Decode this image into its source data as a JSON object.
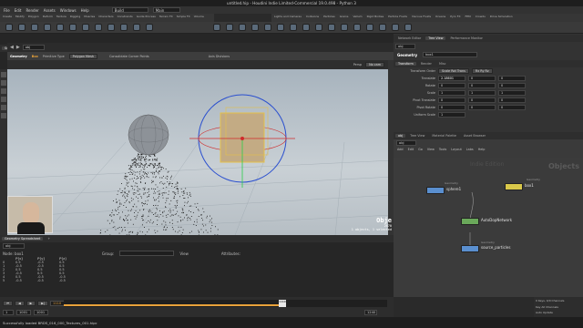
{
  "window": {
    "title": "untitled.hip - Houdini Indie Limited-Commercial 19.0.498 - Python 3"
  },
  "menu": {
    "items": [
      "File",
      "Edit",
      "Render",
      "Assets",
      "Windows",
      "Help"
    ],
    "desktop": "Build",
    "context": "Main"
  },
  "shelf_left": [
    "Create",
    "Modify",
    "Polygon",
    "Deform",
    "Texture",
    "Rigging",
    "Muscles",
    "Characters",
    "Constraints",
    "Guide Process",
    "Terrain FX",
    "Simple FX",
    "Volume"
  ],
  "shelf_right": [
    "Lights and Cameras",
    "Collisions",
    "Particles",
    "Grains",
    "Vellum",
    "Rigid Bodies",
    "Particle Fluids",
    "Viscous Fluids",
    "Oceans",
    "Pyro FX",
    "FEM",
    "Crowds",
    "Drive Simulation"
  ],
  "viewport": {
    "pane_tabs": [
      "Scene View",
      "Animation Editor",
      "Render View",
      "Composite View",
      "Motion FX View",
      "Geometry Spreadsheet"
    ],
    "path": "obj",
    "operator_bar": {
      "context": "Geometry",
      "node": "Box",
      "primitive_type_label": "Primitive Type",
      "primitive_type": "Polygon Mesh",
      "consolidate": "Consolidate Corner Points",
      "axis_label": "Axis Divisions"
    },
    "view_label": "Persp",
    "camera_label": "No cam",
    "status": {
      "title": "Obje",
      "line2": "2670",
      "line3": "1 objects, 1 selected"
    }
  },
  "spreadsheet": {
    "tabs": [
      "Geometry Spreadsheet",
      "+"
    ],
    "path": "obj",
    "node_label": "Node: box1",
    "group_label": "Group:",
    "view_label": "View",
    "attrs_label": "Attributes:",
    "columns": [
      "",
      "P[x]",
      "P[y]",
      "P[z]"
    ],
    "rows": [
      [
        "0",
        "0.5",
        "-0.5",
        "0.5"
      ],
      [
        "1",
        "-0.5",
        "-0.5",
        "0.5"
      ],
      [
        "2",
        "0.5",
        "0.5",
        "0.5"
      ],
      [
        "3",
        "-0.5",
        "0.5",
        "0.5"
      ],
      [
        "4",
        "0.5",
        "-0.5",
        "-0.5"
      ],
      [
        "5",
        "-0.5",
        "-0.5",
        "-0.5"
      ]
    ]
  },
  "timeline": {
    "frame": "1110",
    "start": "1",
    "end": "1001",
    "range_start": "1001",
    "range_end": "1240",
    "end2": "1240",
    "ticks": [
      "1001",
      "1024",
      "1072",
      "1104",
      "1120",
      "1144",
      "1168",
      "1192",
      "1216",
      "1240"
    ]
  },
  "params": {
    "tabs": [
      "Network Editor",
      "Tree View",
      "Performance Monitor"
    ],
    "path": "obj",
    "node_type": "Geometry",
    "node_name": "box1",
    "subtabs": [
      "Transform",
      "Render",
      "Misc"
    ],
    "transform_order_label": "Transform Order",
    "transform_order": "Scale Rot Trans",
    "rot_order": "Rx Ry Rz",
    "rows": [
      {
        "label": "Translate",
        "values": [
          "2.18601",
          "0",
          "0"
        ]
      },
      {
        "label": "Rotate",
        "values": [
          "0",
          "0",
          "0"
        ]
      },
      {
        "label": "Scale",
        "values": [
          "1",
          "1",
          "1"
        ]
      },
      {
        "label": "Pivot Translate",
        "values": [
          "0",
          "0",
          "0"
        ]
      },
      {
        "label": "Pivot Rotate",
        "values": [
          "0",
          "0",
          "0"
        ]
      },
      {
        "label": "Uniform Scale",
        "values": [
          "1"
        ]
      }
    ]
  },
  "network": {
    "tabs": [
      "obj",
      "Tree View",
      "Material Palette",
      "Asset Browser"
    ],
    "menu": [
      "Add",
      "Edit",
      "Go",
      "View",
      "Tools",
      "Layout",
      "Labs",
      "Help"
    ],
    "path": "obj",
    "context_title": "Objects",
    "watermark": "Indie Edition",
    "nodes": [
      {
        "type": "Geometry",
        "name": "sphere1",
        "color": "#5a8fcf"
      },
      {
        "type": "Geometry",
        "name": "box1",
        "color": "#d9c84a"
      },
      {
        "type": "AutoDopNetwork",
        "name": "AutoDopNetwork",
        "color": "#6aa85a"
      },
      {
        "type": "Geometry",
        "name": "source_particles",
        "color": "#5a8fcf"
      }
    ],
    "footer": [
      "0 Keys, 0/0 Channels",
      "Key All Channels",
      "Auto Update"
    ]
  },
  "status_bar": {
    "message": "Successfully loaded BRDS_016_000_Textures_001.hipc"
  },
  "colors": {
    "accent": "#e8a23a",
    "handle_blue": "#2a4fcf",
    "handle_red": "#cf2a2a",
    "handle_green": "#2acf4a",
    "selection": "#e5c04a"
  }
}
